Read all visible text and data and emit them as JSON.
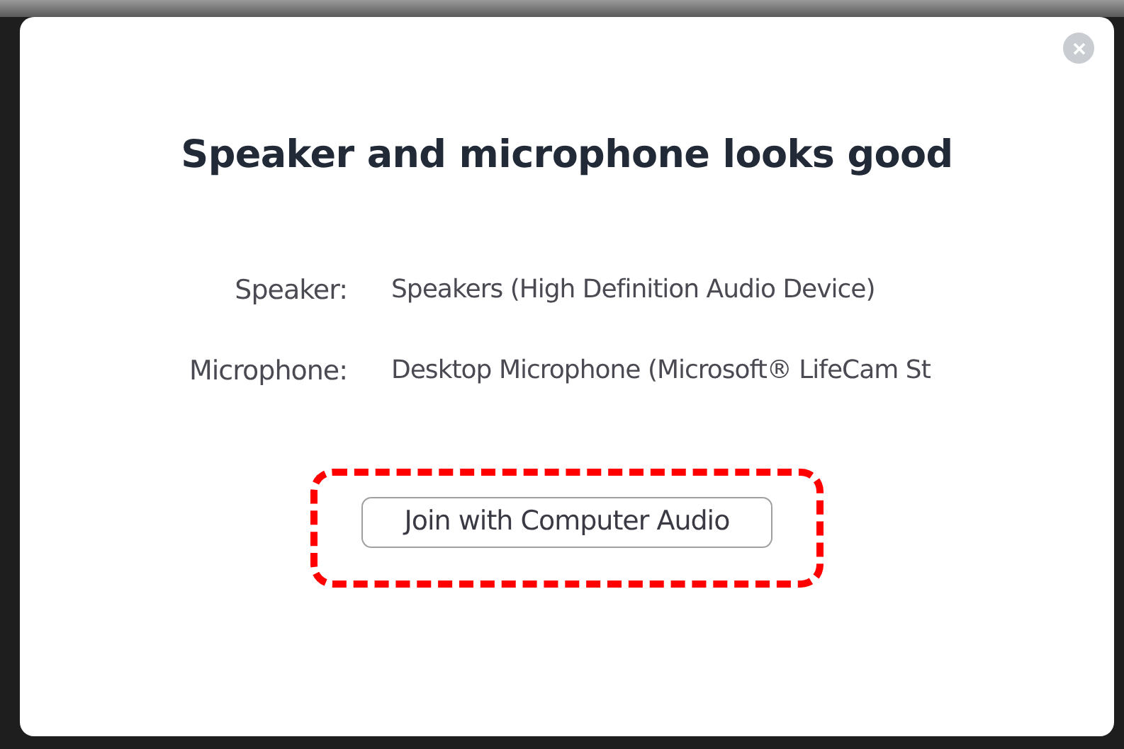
{
  "dialog": {
    "title": "Speaker and microphone looks good",
    "devices": [
      {
        "label": "Speaker:",
        "value": "Speakers (High Definition Audio Device)"
      },
      {
        "label": "Microphone:",
        "value": "Desktop Microphone (Microsoft® LifeCam St"
      }
    ],
    "button": "Join with Computer Audio"
  }
}
